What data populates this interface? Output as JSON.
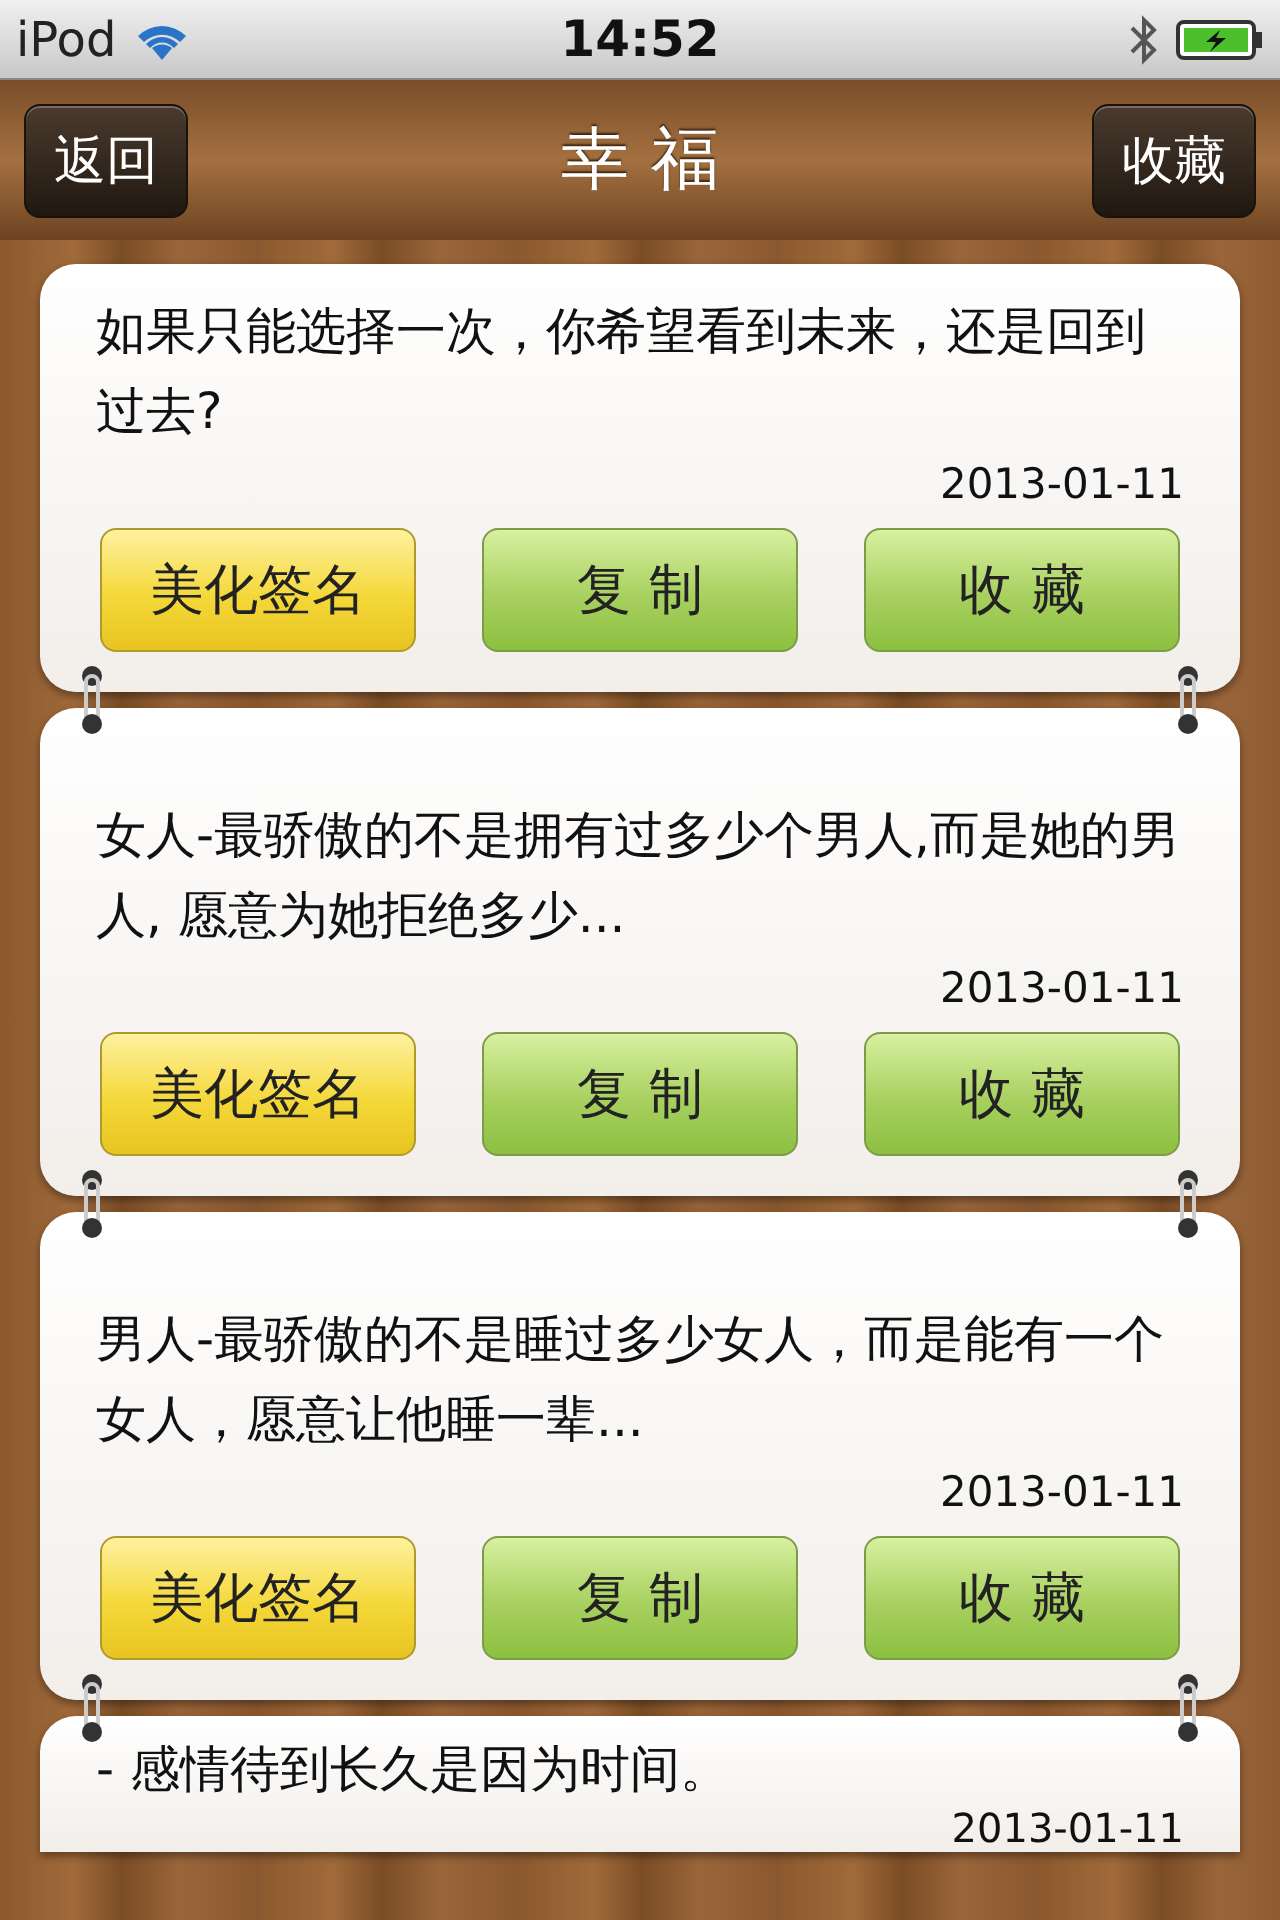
{
  "status_bar": {
    "carrier": "iPod",
    "time": "14:52"
  },
  "nav_bar": {
    "back": "返回",
    "title": "幸 福",
    "action": "收藏"
  },
  "cards": [
    {
      "text": "如果只能选择一次，你希望看到未来，还是回到过去?",
      "date": "2013-01-11",
      "buttons": [
        {
          "label": "美化签名",
          "kind": "accent"
        },
        {
          "label": "复 制",
          "kind": "normal"
        },
        {
          "label": "收 藏",
          "kind": "normal"
        }
      ]
    },
    {
      "text": "女人-最骄傲的不是拥有过多少个男人,而是她的男人, 愿意为她拒绝多少...",
      "date": "2013-01-11",
      "buttons": [
        {
          "label": "美化签名",
          "kind": "accent"
        },
        {
          "label": "复 制",
          "kind": "normal"
        },
        {
          "label": "收 藏",
          "kind": "normal"
        }
      ]
    },
    {
      "text": "男人-最骄傲的不是睡过多少女人，而是能有一个女人，愿意让他睡一辈...",
      "date": "2013-01-11",
      "buttons": [
        {
          "label": "美化签名",
          "kind": "accent"
        },
        {
          "label": "复 制",
          "kind": "normal"
        },
        {
          "label": "收 藏",
          "kind": "normal"
        }
      ]
    },
    {
      "text": "-    感情待到长久是因为时间。",
      "date": "2013-01-11"
    }
  ]
}
